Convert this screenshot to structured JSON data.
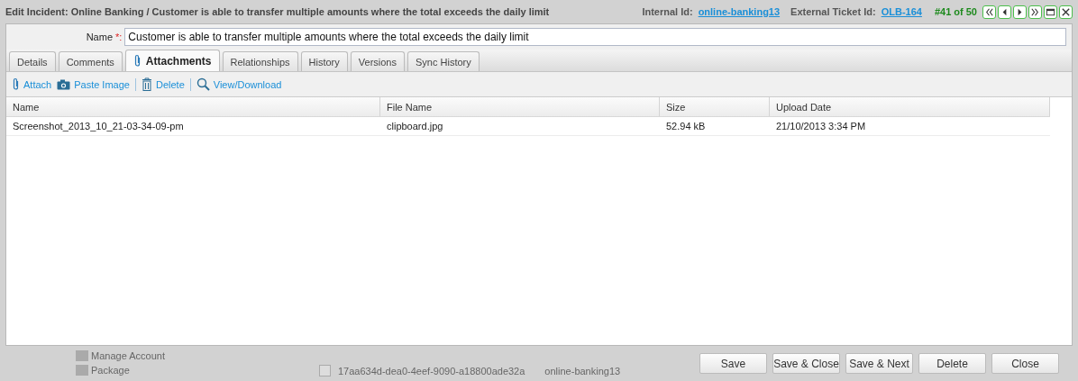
{
  "dialog": {
    "title": "Edit Incident: Online Banking / Customer is able to transfer multiple amounts where the total exceeds the daily limit",
    "internal_id_label": "Internal Id:",
    "internal_id": "online-banking13",
    "external_id_label": "External Ticket Id:",
    "external_id": "OLB-164",
    "position": "#41 of 50"
  },
  "name_field": {
    "label": "Name",
    "required_mark": "*:",
    "value": "Customer is able to transfer multiple amounts where the total exceeds the daily limit"
  },
  "tabs": [
    {
      "label": "Details",
      "selected": false
    },
    {
      "label": "Comments",
      "selected": false
    },
    {
      "label": "Attachments",
      "selected": true
    },
    {
      "label": "Relationships",
      "selected": false
    },
    {
      "label": "History",
      "selected": false
    },
    {
      "label": "Versions",
      "selected": false
    },
    {
      "label": "Sync History",
      "selected": false
    }
  ],
  "toolbar": [
    {
      "kind": "attach",
      "label": "Attach"
    },
    {
      "kind": "camera",
      "label": "Paste Image"
    },
    {
      "kind": "delete",
      "label": "Delete"
    },
    {
      "kind": "search",
      "label": "View/Download"
    }
  ],
  "table": {
    "columns": [
      "Name",
      "File Name",
      "Size",
      "Upload Date"
    ],
    "rows": [
      [
        "Screenshot_2013_10_21-03-34-09-pm",
        "clipboard.jpg",
        "52.94 kB",
        "21/10/2013 3:34 PM"
      ]
    ]
  },
  "background": {
    "tree_items": [
      "Manage Account",
      "Package"
    ],
    "row": [
      "17aa634d-dea0-4eef-9090-a18800ade32a",
      "online-banking13"
    ],
    "checked": false
  },
  "buttons": [
    "Save",
    "Save & Close",
    "Save & Next",
    "Delete",
    "Close"
  ]
}
